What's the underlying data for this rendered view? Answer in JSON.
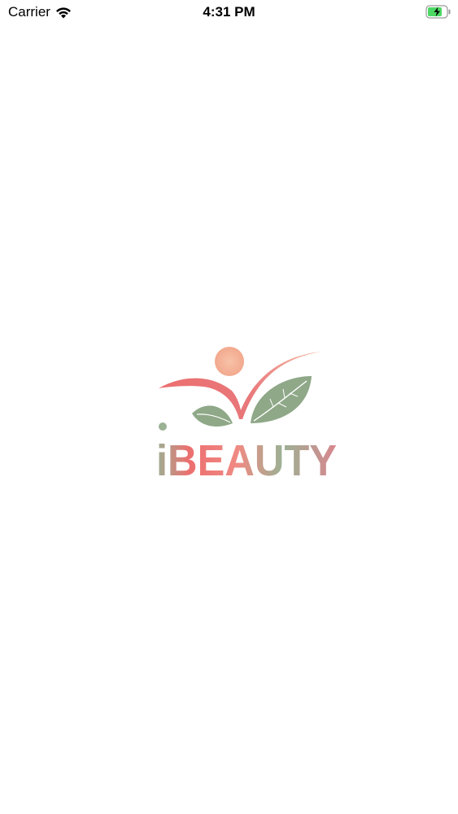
{
  "status_bar": {
    "carrier": "Carrier",
    "time": "4:31 PM",
    "battery_icon": "battery-charging-icon",
    "wifi_icon": "wifi-icon",
    "battery_color": "#4cd964"
  },
  "splash": {
    "logo_text": "iBEAUTY",
    "colors": {
      "coral": "#ec6f6f",
      "peach": "#f5b8a0",
      "sage": "#8fa888"
    }
  }
}
